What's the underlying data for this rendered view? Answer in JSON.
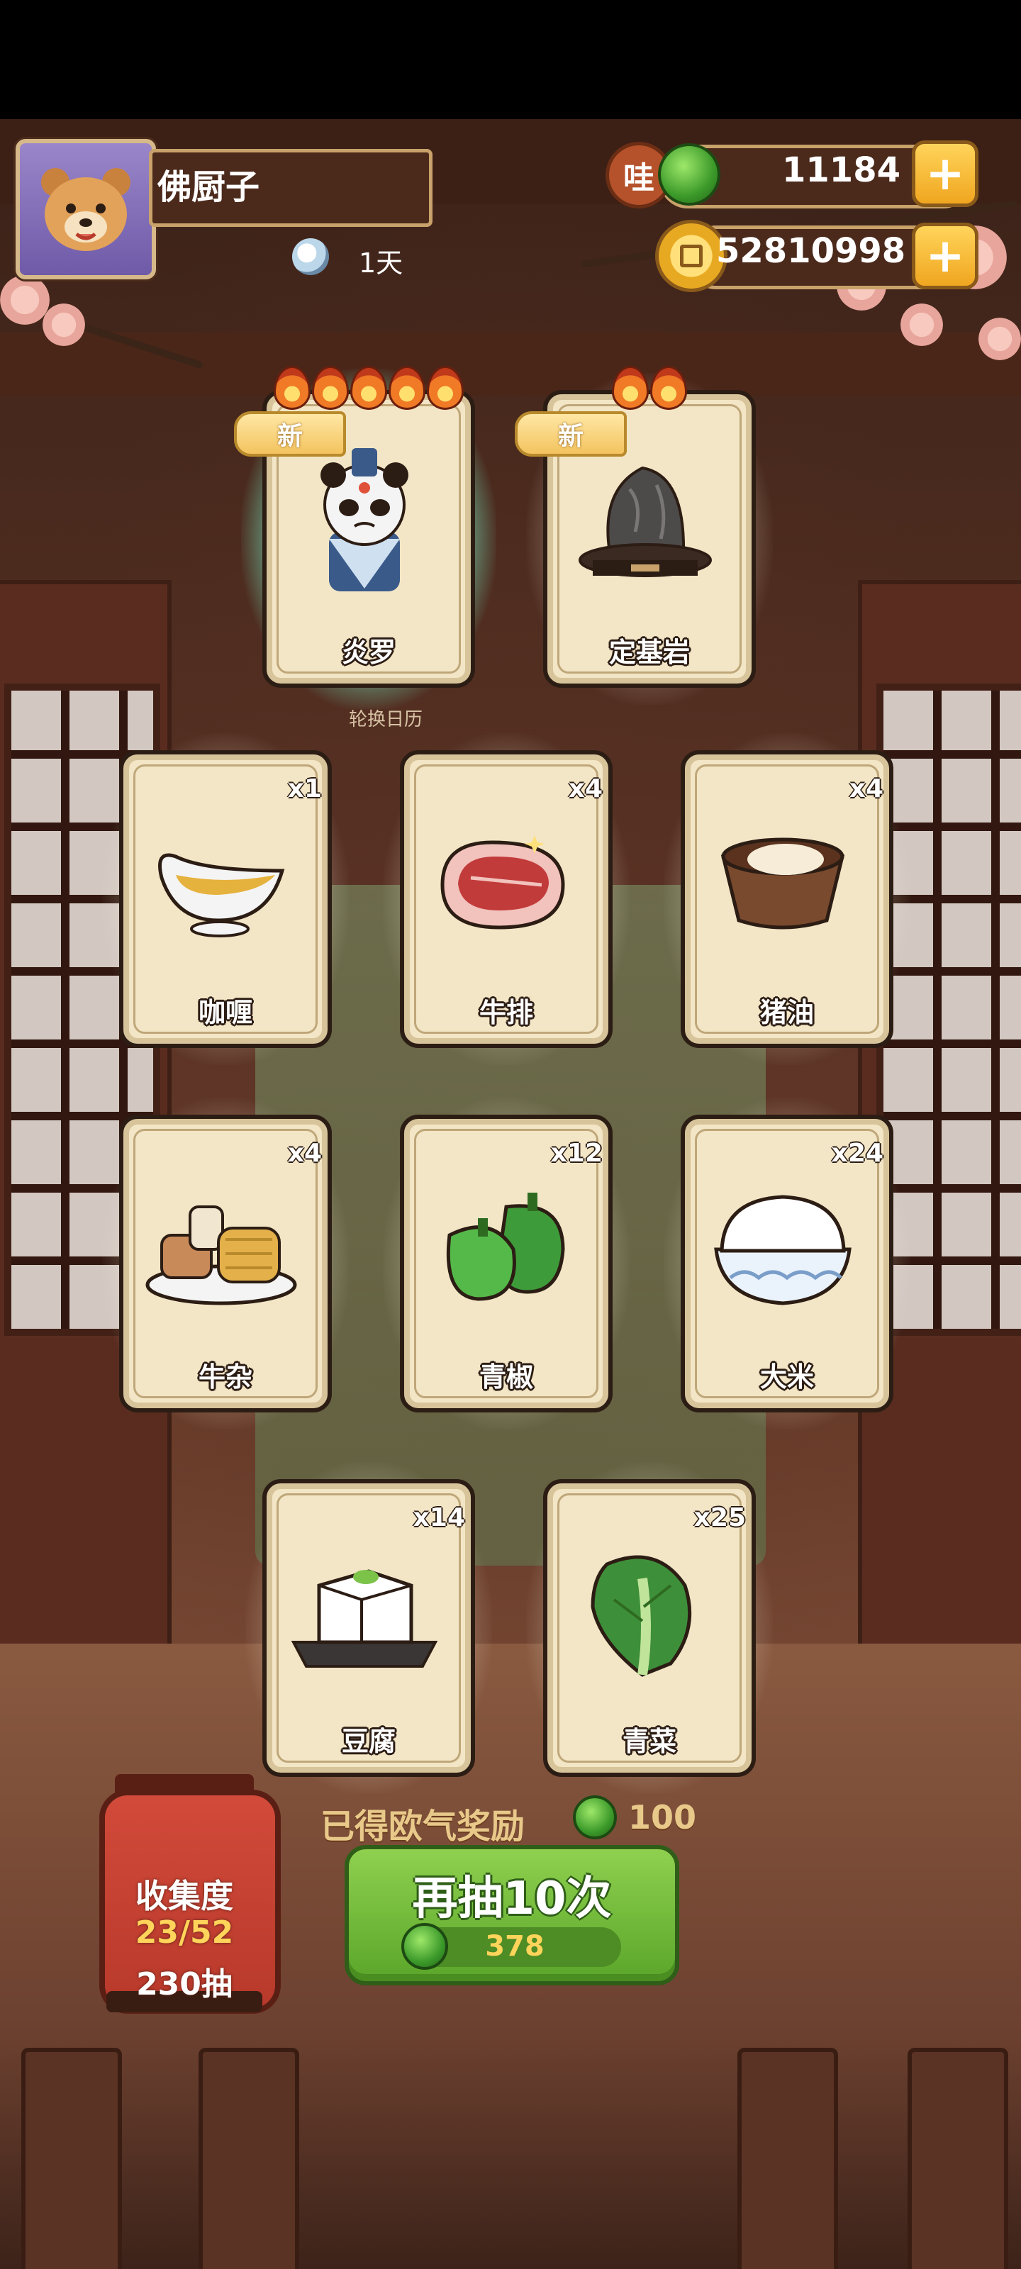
{
  "player": {
    "name": "佛厨子",
    "day_label": "1天"
  },
  "resources": {
    "jade": {
      "badge": "哇",
      "value": "11184"
    },
    "coins": {
      "value": "52810998"
    },
    "plus_label": "+"
  },
  "new_tag": "新",
  "calendar_label": "轮换日历",
  "featured_cards": [
    {
      "name": "炎罗",
      "stars": 5
    },
    {
      "name": "定基岩",
      "stars": 2
    }
  ],
  "ingredient_cards": [
    {
      "name": "咖喱",
      "count": "x1"
    },
    {
      "name": "牛排",
      "count": "x4"
    },
    {
      "name": "猪油",
      "count": "x4"
    },
    {
      "name": "牛杂",
      "count": "x4"
    },
    {
      "name": "青椒",
      "count": "x12"
    },
    {
      "name": "大米",
      "count": "x24"
    },
    {
      "name": "豆腐",
      "count": "x14"
    },
    {
      "name": "青菜",
      "count": "x25"
    }
  ],
  "reward": {
    "label": "已得欧气奖励",
    "value": "100"
  },
  "draw_button": {
    "label": "再抽10次",
    "cost": "378"
  },
  "collection": {
    "title": "收集度",
    "progress": "23/52",
    "draws": "230抽"
  }
}
